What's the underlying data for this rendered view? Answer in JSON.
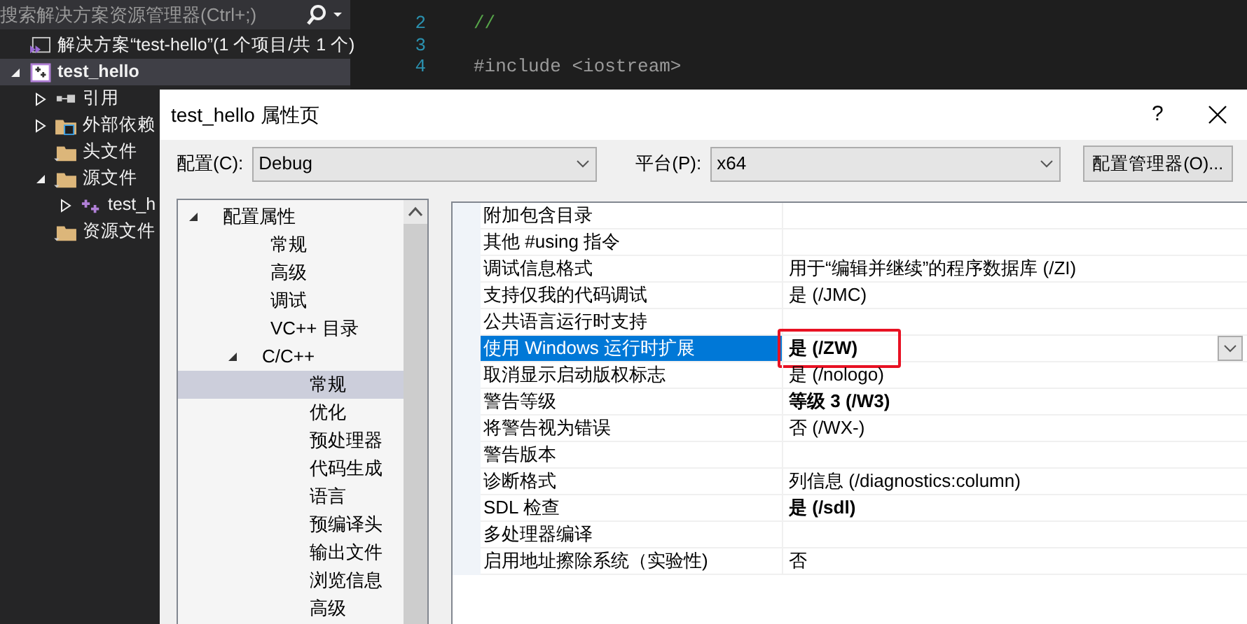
{
  "solution_explorer": {
    "search_placeholder": "搜索解决方案资源管理器(Ctrl+;)",
    "items": [
      {
        "kind": "solution",
        "label": "解决方案“test-hello”(1 个项目/共 1 个)",
        "selected": false
      },
      {
        "kind": "project",
        "label": "test_hello",
        "selected": true,
        "expanded": true,
        "children": [
          {
            "kind": "references",
            "label": "引用",
            "selected": false,
            "expanded": false
          },
          {
            "kind": "external",
            "label": "外部依赖",
            "selected": false,
            "expanded": false
          },
          {
            "kind": "folder",
            "label": "头文件",
            "selected": false
          },
          {
            "kind": "folder",
            "label": "源文件",
            "selected": false,
            "expanded": true,
            "children": [
              {
                "kind": "cpp",
                "label": "test_h",
                "selected": false,
                "expanded": false
              }
            ]
          },
          {
            "kind": "folder",
            "label": "资源文件",
            "selected": false
          }
        ]
      }
    ]
  },
  "editor": {
    "lines": [
      {
        "number": "2",
        "code": "//",
        "kind": "comment"
      },
      {
        "number": "3",
        "kind": "plain"
      },
      {
        "number": "4",
        "code": "#include <iostream>",
        "kind": "include"
      }
    ]
  },
  "dialog": {
    "title": "test_hello 属性页",
    "help": "?",
    "configuration": {
      "label": "配置(C):",
      "value": "Debug"
    },
    "platform": {
      "label": "平台(P):",
      "value": "x64"
    },
    "manager_button": "配置管理器(O)...",
    "tree": [
      {
        "label": "配置属性",
        "expanded": true,
        "selected": false,
        "children": [
          {
            "label": "常规",
            "selected": false
          },
          {
            "label": "高级",
            "selected": false
          },
          {
            "label": "调试",
            "selected": false
          },
          {
            "label": "VC++ 目录",
            "selected": false
          },
          {
            "label": "C/C++",
            "expanded": true,
            "selected": false,
            "children": [
              {
                "label": "常规",
                "selected": true
              },
              {
                "label": "优化",
                "selected": false
              },
              {
                "label": "预处理器",
                "selected": false
              },
              {
                "label": "代码生成",
                "selected": false
              },
              {
                "label": "语言",
                "selected": false
              },
              {
                "label": "预编译头",
                "selected": false
              },
              {
                "label": "输出文件",
                "selected": false
              },
              {
                "label": "浏览信息",
                "selected": false
              },
              {
                "label": "高级",
                "selected": false
              }
            ]
          }
        ]
      }
    ],
    "properties": [
      {
        "name": "附加包含目录",
        "selected": false
      },
      {
        "name": "其他 #using 指令",
        "selected": false
      },
      {
        "name": "调试信息格式",
        "value": "用于“编辑并继续”的程序数据库 (/ZI)",
        "bold": false,
        "selected": false
      },
      {
        "name": "支持仅我的代码调试",
        "value": "是 (/JMC)",
        "bold": false,
        "selected": false
      },
      {
        "name": "公共语言运行时支持",
        "selected": false
      },
      {
        "name": "使用 Windows 运行时扩展",
        "value": "是 (/ZW)",
        "bold": true,
        "selected": true,
        "outlined": true
      },
      {
        "name": "取消显示启动版权标志",
        "value": "是 (/nologo)",
        "bold": false,
        "selected": false
      },
      {
        "name": "警告等级",
        "value": "等级 3 (/W3)",
        "bold": true,
        "selected": false
      },
      {
        "name": "将警告视为错误",
        "value": "否 (/WX-)",
        "bold": false,
        "selected": false
      },
      {
        "name": "警告版本",
        "selected": false
      },
      {
        "name": "诊断格式",
        "value": "列信息 (/diagnostics:column)",
        "bold": false,
        "selected": false
      },
      {
        "name": "SDL 检查",
        "value": "是 (/sdl)",
        "bold": true,
        "selected": false
      },
      {
        "name": "多处理器编译",
        "selected": false
      },
      {
        "name": "启用地址擦除系统（实验性)",
        "value": "否",
        "bold": false,
        "selected": false
      }
    ]
  }
}
